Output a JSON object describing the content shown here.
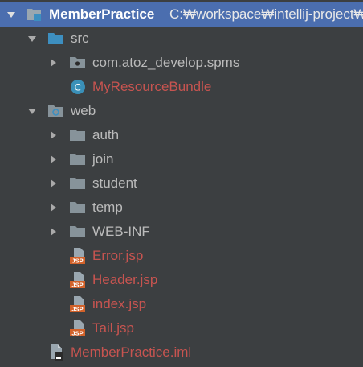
{
  "root": {
    "name": "MemberPractice",
    "path": "C:₩workspace₩intellij-project₩"
  },
  "nodes": {
    "src": "src",
    "package": "com.atoz_develop.spms",
    "bundle": "MyResourceBundle",
    "web": "web",
    "auth": "auth",
    "join": "join",
    "student": "student",
    "temp": "temp",
    "webinf": "WEB-INF",
    "error_jsp": "Error.jsp",
    "header_jsp": "Header.jsp",
    "index_jsp": "index.jsp",
    "tail_jsp": "Tail.jsp",
    "iml": "MemberPractice.iml"
  },
  "colors": {
    "background": "#3c3f41",
    "selection": "#4b6eaf",
    "text": "#bbbbbb",
    "unversioned": "#c75450",
    "folder": "#87939a",
    "source_folder": "#3d8fc0",
    "jsp_badge": "#d2622a"
  },
  "icons": {
    "collapse": "chevron-down-icon",
    "expand": "chevron-right-icon",
    "module": "module-folder-icon",
    "source": "source-folder-icon",
    "package": "package-icon",
    "class": "class-icon",
    "web": "web-folder-icon",
    "folder": "folder-icon",
    "jsp": "jsp-file-icon",
    "iml": "iml-file-icon"
  }
}
